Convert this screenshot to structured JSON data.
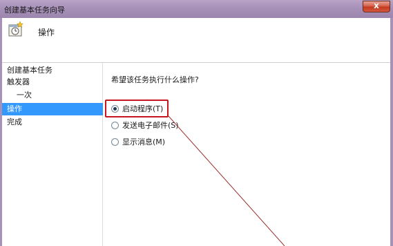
{
  "window": {
    "title": "创建基本任务向导",
    "close_label": "x"
  },
  "header": {
    "heading": "操作",
    "icon": "task-scheduler-icon"
  },
  "steps": [
    {
      "label": "创建基本任务",
      "selected": false
    },
    {
      "label": "触发器",
      "selected": false
    },
    {
      "label": "一次",
      "selected": false
    },
    {
      "label": "操作",
      "selected": true
    },
    {
      "label": "完成",
      "selected": false
    }
  ],
  "main": {
    "question": "希望该任务执行什么操作?",
    "options": [
      {
        "label": "启动程序(T)",
        "checked": true
      },
      {
        "label": "发送电子邮件(S)",
        "checked": false
      },
      {
        "label": "显示消息(M)",
        "checked": false
      }
    ]
  },
  "colors": {
    "title_bar": "#a891b9",
    "selected_step": "#3399ff",
    "highlight": "#c4161c",
    "annotation_line": "#9b2b2b"
  }
}
